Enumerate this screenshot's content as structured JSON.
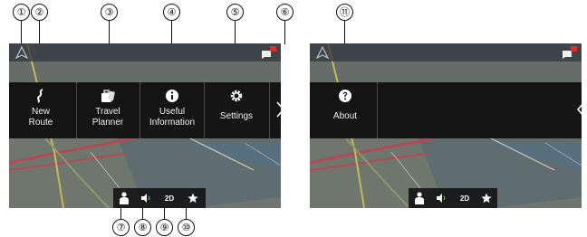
{
  "callouts": {
    "c1": "①",
    "c2": "②",
    "c3": "③",
    "c4": "④",
    "c5": "⑤",
    "c6": "⑥",
    "c7": "⑦",
    "c8": "⑧",
    "c9": "⑨",
    "c10": "⑩",
    "c11": "⑪"
  },
  "left_screen": {
    "menu": [
      {
        "label": "New\nRoute",
        "icon": "new-route-icon"
      },
      {
        "label": "Travel\nPlanner",
        "icon": "travel-planner-icon"
      },
      {
        "label": "Useful\nInformation",
        "icon": "info-icon"
      },
      {
        "label": "Settings",
        "icon": "gear-icon"
      }
    ],
    "bottom": {
      "view_mode": "2D"
    }
  },
  "right_screen": {
    "menu": [
      {
        "label": "About",
        "icon": "about-icon"
      }
    ],
    "bottom": {
      "view_mode": "2D"
    }
  },
  "colors": {
    "map_bg": "#6d746c",
    "menu_bg": "#141414",
    "road_red": "#b34a55",
    "road_yellow": "#c8b85a",
    "water": "#5e87a4"
  }
}
